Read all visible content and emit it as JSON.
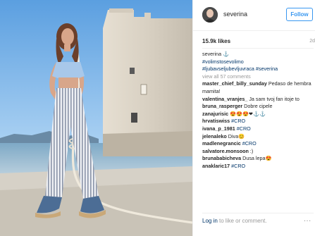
{
  "post": {
    "username": "severina",
    "follow_label": "Follow",
    "likes": "15.9k likes",
    "age": "2d",
    "caption": {
      "author": "severina",
      "emoji": "⚓",
      "tags": [
        "#volimstosevolimo",
        "#ljubavseljubevljuvraca",
        "#severina"
      ]
    },
    "view_all": "view all 57 comments",
    "comments": [
      {
        "user": "master_chief_billy_sunday",
        "text": "Pedaso de hembra mamita!"
      },
      {
        "user": "valentina_vranjes_",
        "text": "Ja sam tvoj fan itoje to"
      },
      {
        "user": "bruna_rasperger",
        "text": "Dobre cipele"
      },
      {
        "user": "zanajurisic",
        "text": "😍😍😍❤⚓⚓"
      },
      {
        "user": "hrvatiswiss",
        "text": "#CRO"
      },
      {
        "user": "ivana_p_1981",
        "text": "#CRO"
      },
      {
        "user": "jelenaleko",
        "text": "Diva😊"
      },
      {
        "user": "madlenegrancic",
        "text": "#CRO"
      },
      {
        "user": "salvatore.monsoon",
        "text": ":)"
      },
      {
        "user": "brunababicheva",
        "text": "Dusa lepa😍"
      },
      {
        "user": "anaklaric17",
        "text": "#CRO"
      }
    ],
    "footer": {
      "login": "Log in",
      "rest": " to like or comment.",
      "more": "..."
    }
  },
  "colors": {
    "link": "#003569",
    "follow_blue": "#3897f0",
    "muted": "#999999",
    "sky": "#9ec9ef"
  }
}
